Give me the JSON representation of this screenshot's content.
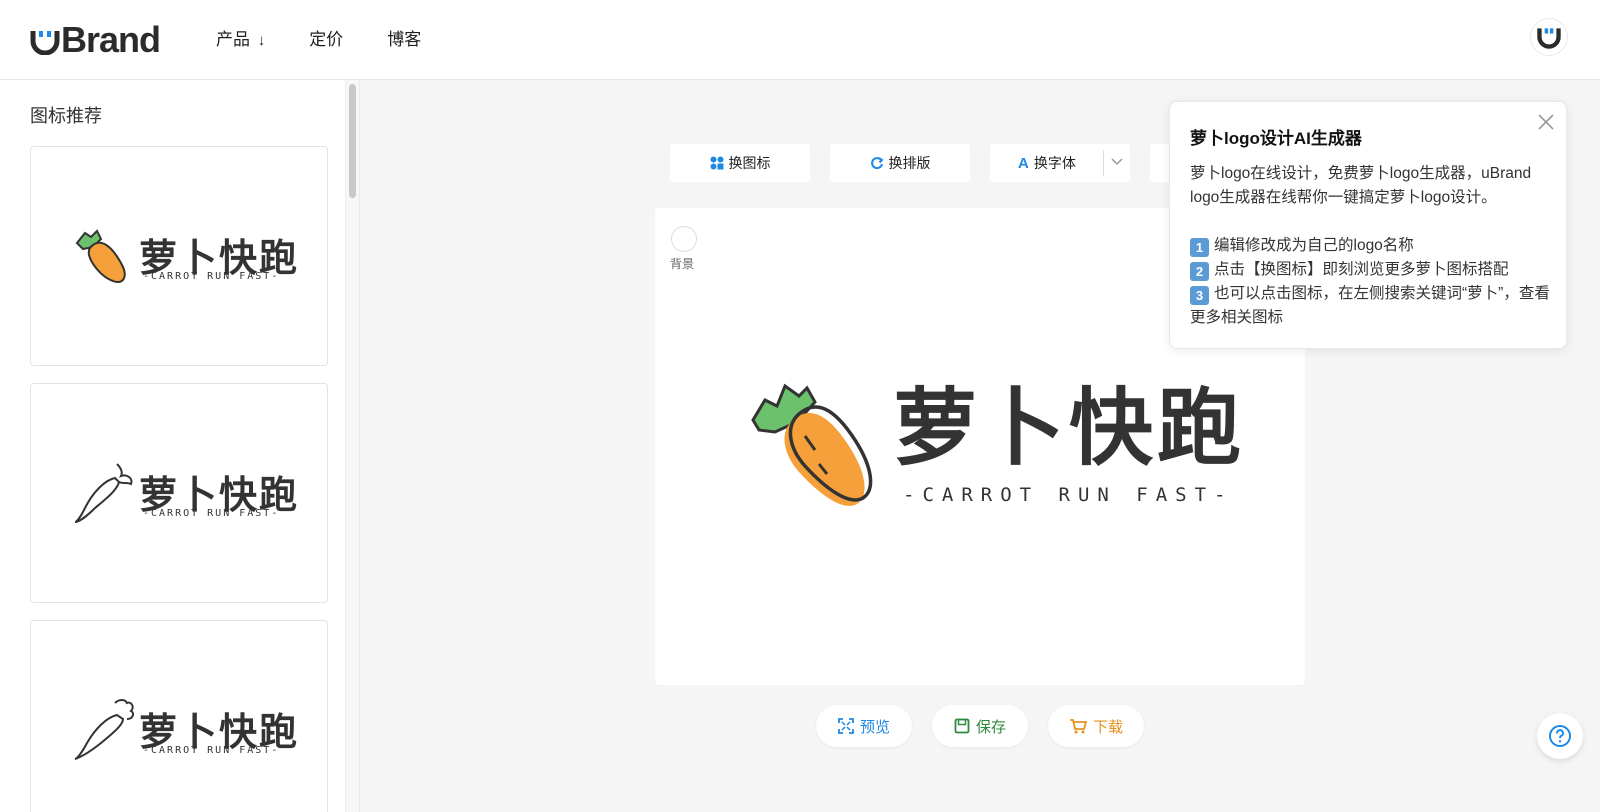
{
  "header": {
    "brand": "Brand",
    "nav": [
      {
        "label": "产品",
        "icon": "arrow-down-icon"
      },
      {
        "label": "定价"
      },
      {
        "label": "博客"
      }
    ]
  },
  "sidebar": {
    "title": "图标推荐",
    "cards": [
      {
        "name": "萝卜快跑",
        "tagline": "-CARROT RUN FAST-",
        "style": "color"
      },
      {
        "name": "萝卜快跑",
        "tagline": "-CARROT RUN FAST-",
        "style": "outline-left"
      },
      {
        "name": "萝卜快跑",
        "tagline": "-CARROT RUN FAST-",
        "style": "outline-right"
      }
    ]
  },
  "toolbar": {
    "change_icon": "换图标",
    "change_layout": "换排版",
    "change_font": "换字体"
  },
  "canvas": {
    "background_label": "背景",
    "logo_name": "萝卜快跑",
    "logo_tagline": "-CARROT RUN FAST-"
  },
  "actions": {
    "preview": "预览",
    "save": "保存",
    "download": "下载"
  },
  "popup": {
    "title": "萝卜logo设计AI生成器",
    "intro": "萝卜logo在线设计，免费萝卜logo生成器，uBrand logo生成器在线帮你一键搞定萝卜logo设计。",
    "steps": [
      {
        "num": "1",
        "text": "编辑修改成为自己的logo名称"
      },
      {
        "num": "2",
        "text": "点击【换图标】即刻浏览更多萝卜图标搭配"
      },
      {
        "num": "3",
        "text": "也可以点击图标，在左侧搜索关键词“萝卜”，查看更多相关图标"
      }
    ]
  },
  "colors": {
    "accent_blue": "#1e88e5",
    "save_green": "#2e8b3e",
    "download_orange": "#e8901e",
    "carrot_orange": "#f5a03a",
    "leaf_green": "#6cc26c"
  }
}
